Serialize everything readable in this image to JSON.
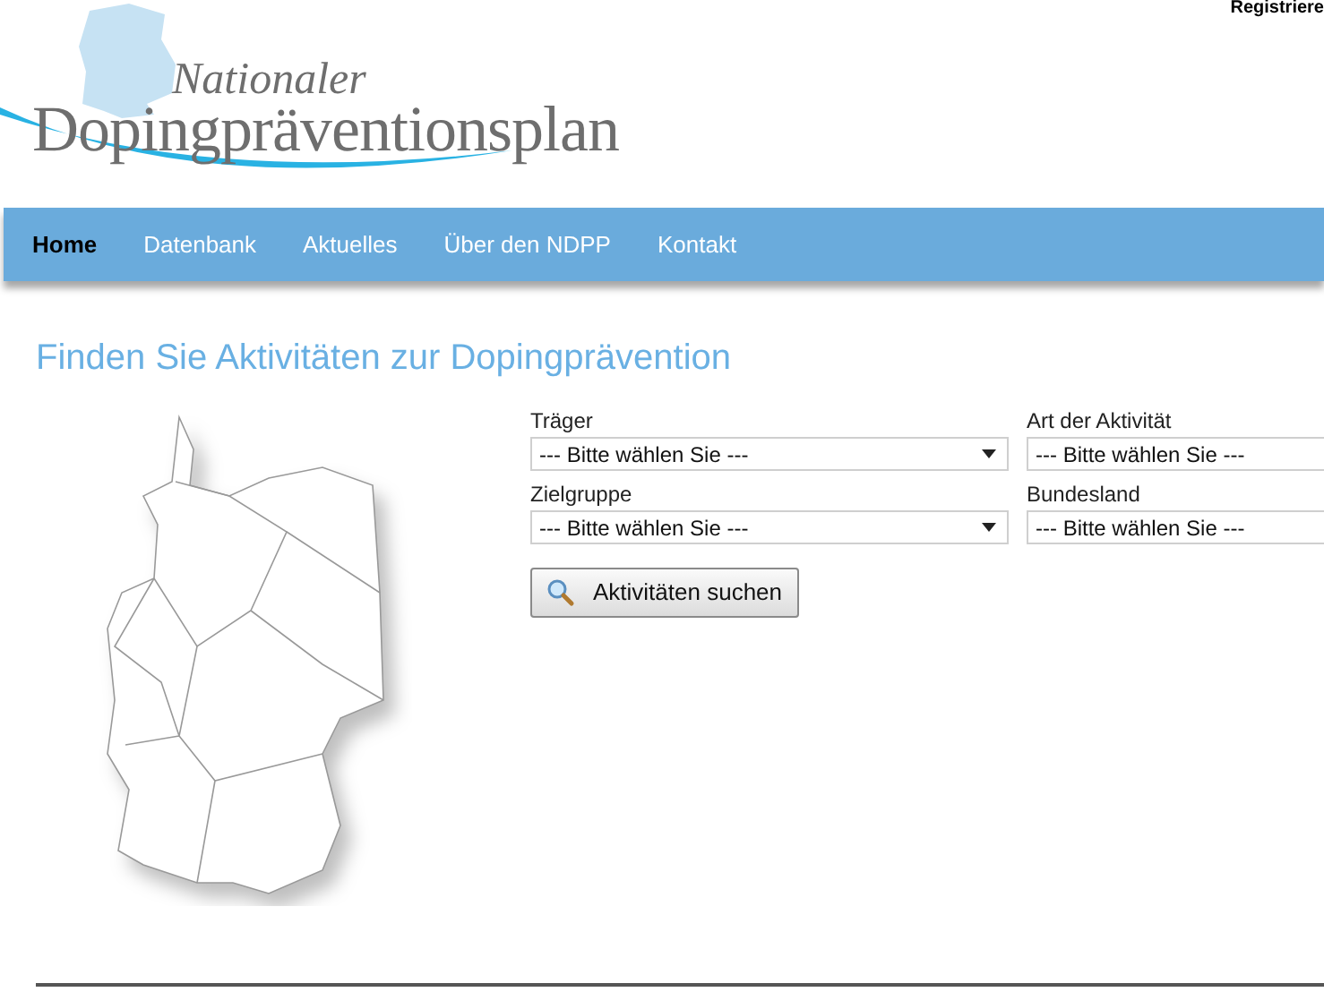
{
  "top_link": "Registriere",
  "logo": {
    "line_1": "Nationaler",
    "line_2": "Dopingpräventionsplan"
  },
  "nav": [
    {
      "label": "Home",
      "selected": true
    },
    {
      "label": "Datenbank",
      "selected": false
    },
    {
      "label": "Aktuelles",
      "selected": false
    },
    {
      "label": "Über den NDPP",
      "selected": false
    },
    {
      "label": "Kontakt",
      "selected": false
    }
  ],
  "heading": "Finden Sie Aktivitäten zur Dopingprävention",
  "filters": [
    {
      "label": "Träger",
      "value": "--- Bitte wählen Sie ---"
    },
    {
      "label": "Art der Aktivität",
      "value": "--- Bitte wählen Sie ---"
    },
    {
      "label": "Zielgruppe",
      "value": "--- Bitte wählen Sie ---"
    },
    {
      "label": "Bundesland",
      "value": "--- Bitte wählen Sie ---"
    }
  ],
  "search_button": "Aktivitäten suchen"
}
